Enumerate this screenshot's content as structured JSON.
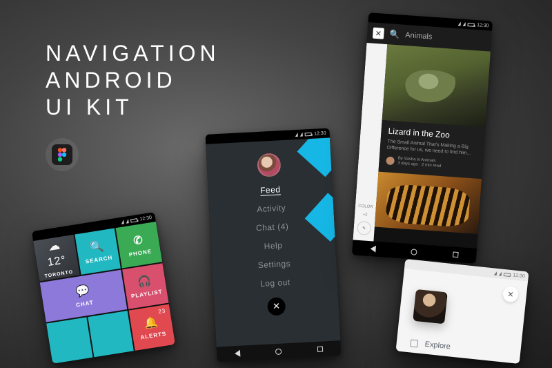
{
  "title_lines": {
    "l1": "NAVIGATION",
    "l2": "ANDROID",
    "l3": "UI KIT"
  },
  "status_time": "12:30",
  "phone1": {
    "weather": {
      "temp": "12°",
      "city": "TORONTO"
    },
    "tiles": {
      "search": "SEARCH",
      "phone": "PHONE",
      "chat": "CHAT",
      "playlist": "PLAYLIST",
      "alerts": "ALERTS",
      "alerts_count": "23"
    }
  },
  "phone2": {
    "items": [
      {
        "label": "Feed",
        "active": true
      },
      {
        "label": "Activity"
      },
      {
        "label": "Chat (4)"
      },
      {
        "label": "Help"
      },
      {
        "label": "Settings"
      },
      {
        "label": "Log out"
      }
    ]
  },
  "phone3": {
    "search_label": "Animals",
    "color_label": "COLOR",
    "color_count": "+2",
    "card": {
      "title": "Lizard in the Zoo",
      "subtitle": "The Small Animal That's Making a Big Difference for us, we need to find him...",
      "byline": "By Sasha in Animals",
      "meta": "3 days ago · 2 min read"
    }
  },
  "phone4": {
    "explore": "Explore"
  },
  "colors": {
    "teal": "#22b8c2",
    "green": "#3aaa55",
    "purple": "#8d79d9",
    "pink": "#d94f6e",
    "red": "#e0494f",
    "accent": "#16b7e5"
  }
}
